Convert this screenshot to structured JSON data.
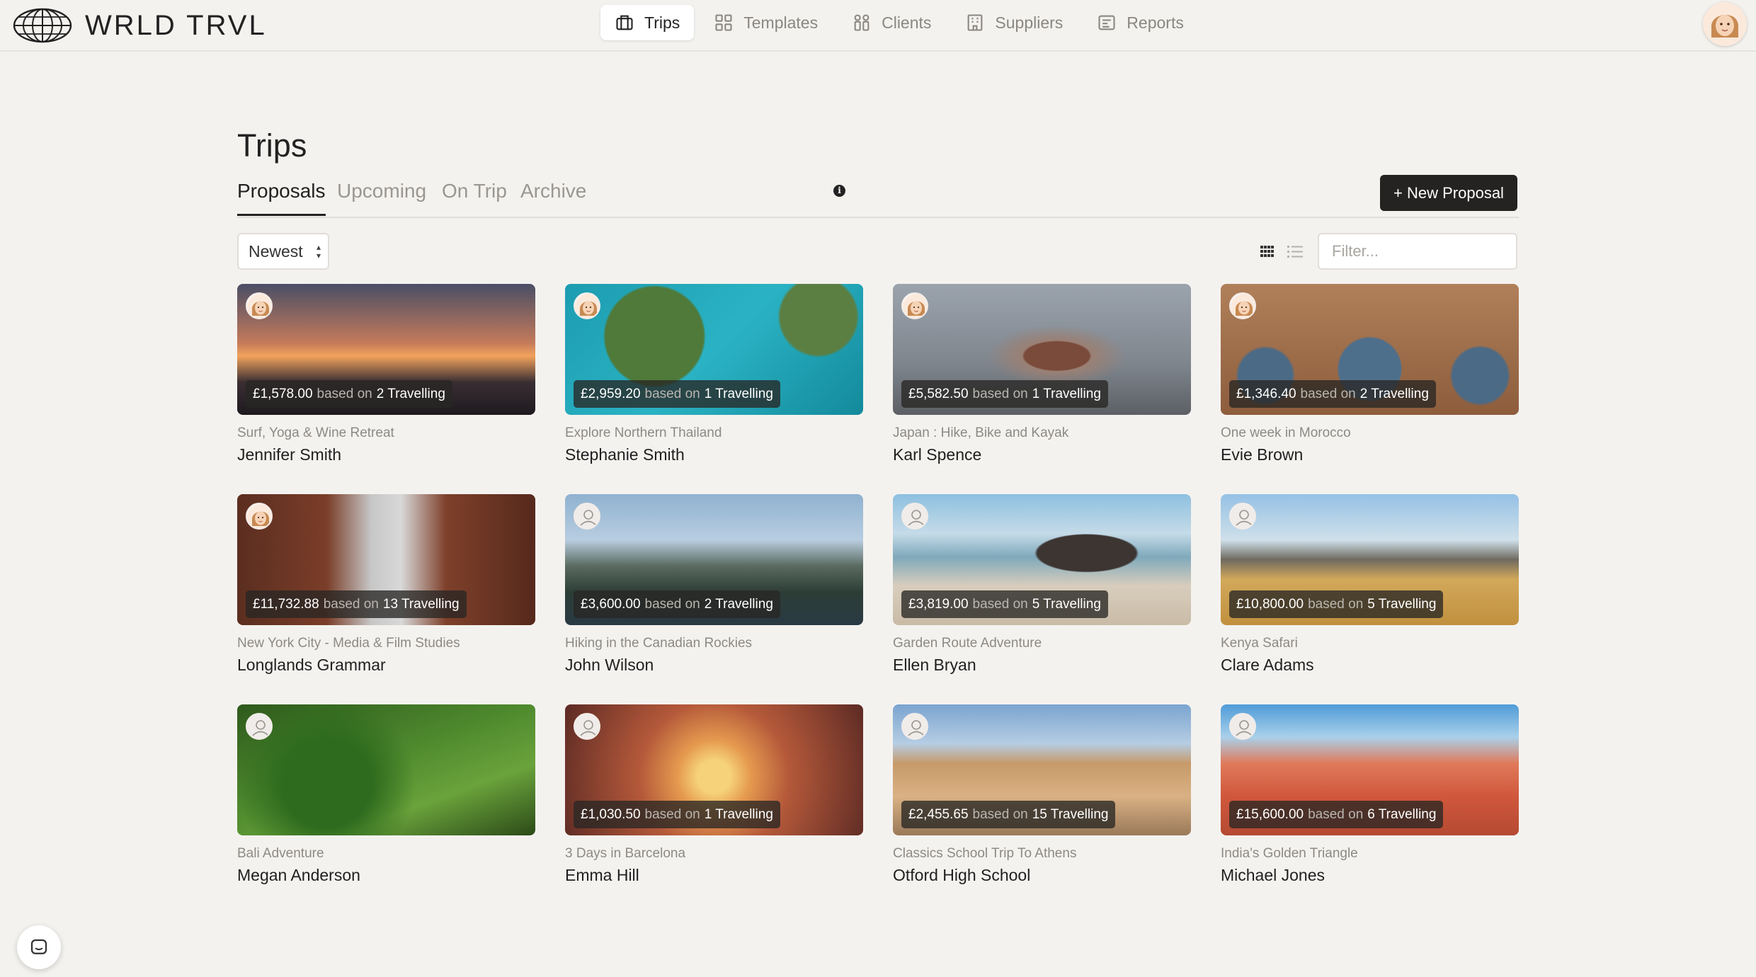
{
  "app": {
    "logo_text": "WRLD TRVL"
  },
  "nav": {
    "items": [
      {
        "label": "Trips",
        "icon": "briefcase-icon",
        "active": true
      },
      {
        "label": "Templates",
        "icon": "grid-icon",
        "active": false
      },
      {
        "label": "Clients",
        "icon": "people-icon",
        "active": false
      },
      {
        "label": "Suppliers",
        "icon": "building-icon",
        "active": false
      },
      {
        "label": "Reports",
        "icon": "report-icon",
        "active": false
      }
    ]
  },
  "page": {
    "title": "Trips",
    "tabs": [
      "Proposals",
      "Upcoming",
      "On Trip",
      "Archive"
    ],
    "active_tab": "Proposals",
    "new_button": "+ New Proposal",
    "sort_value": "Newest",
    "filter_placeholder": "Filter..."
  },
  "cards": [
    {
      "price": "£1,578.00",
      "mid": "based on",
      "travellers": "2 Travelling",
      "trip": "Surf, Yoga & Wine Retreat",
      "client": "Jennifer Smith",
      "avatar": "photo"
    },
    {
      "price": "£2,959.20",
      "mid": "based on",
      "travellers": "1 Travelling",
      "trip": "Explore Northern Thailand",
      "client": "Stephanie Smith",
      "avatar": "photo"
    },
    {
      "price": "£5,582.50",
      "mid": "based on",
      "travellers": "1 Travelling",
      "trip": "Japan : Hike, Bike and Kayak",
      "client": "Karl Spence",
      "avatar": "photo"
    },
    {
      "price": "£1,346.40",
      "mid": "based on",
      "travellers": "2 Travelling",
      "trip": "One week in Morocco",
      "client": "Evie Brown",
      "avatar": "photo"
    },
    {
      "price": "£11,732.88",
      "mid": "based on",
      "travellers": "13 Travelling",
      "trip": "New York City - Media & Film Studies",
      "client": "Longlands Grammar",
      "avatar": "photo"
    },
    {
      "price": "£3,600.00",
      "mid": "based on",
      "travellers": "2 Travelling",
      "trip": "Hiking in the Canadian Rockies",
      "client": "John Wilson",
      "avatar": "generic"
    },
    {
      "price": "£3,819.00",
      "mid": "based on",
      "travellers": "5 Travelling",
      "trip": "Garden Route Adventure",
      "client": "Ellen Bryan",
      "avatar": "generic"
    },
    {
      "price": "£10,800.00",
      "mid": "based on",
      "travellers": "5 Travelling",
      "trip": "Kenya Safari",
      "client": "Clare Adams",
      "avatar": "generic"
    },
    {
      "price": "",
      "mid": "",
      "travellers": "",
      "trip": "Bali Adventure",
      "client": "Megan Anderson",
      "avatar": "generic"
    },
    {
      "price": "£1,030.50",
      "mid": "based on",
      "travellers": "1 Travelling",
      "trip": "3 Days in Barcelona",
      "client": "Emma Hill",
      "avatar": "generic"
    },
    {
      "price": "£2,455.65",
      "mid": "based on",
      "travellers": "15 Travelling",
      "trip": "Classics School Trip To Athens",
      "client": "Otford High School",
      "avatar": "generic"
    },
    {
      "price": "£15,600.00",
      "mid": "based on",
      "travellers": "6 Travelling",
      "trip": "India's Golden Triangle",
      "client": "Michael Jones",
      "avatar": "generic"
    }
  ],
  "icons": {
    "chat": "chat-icon",
    "grid_view": "grid-view-icon",
    "list_view": "list-view-icon"
  }
}
